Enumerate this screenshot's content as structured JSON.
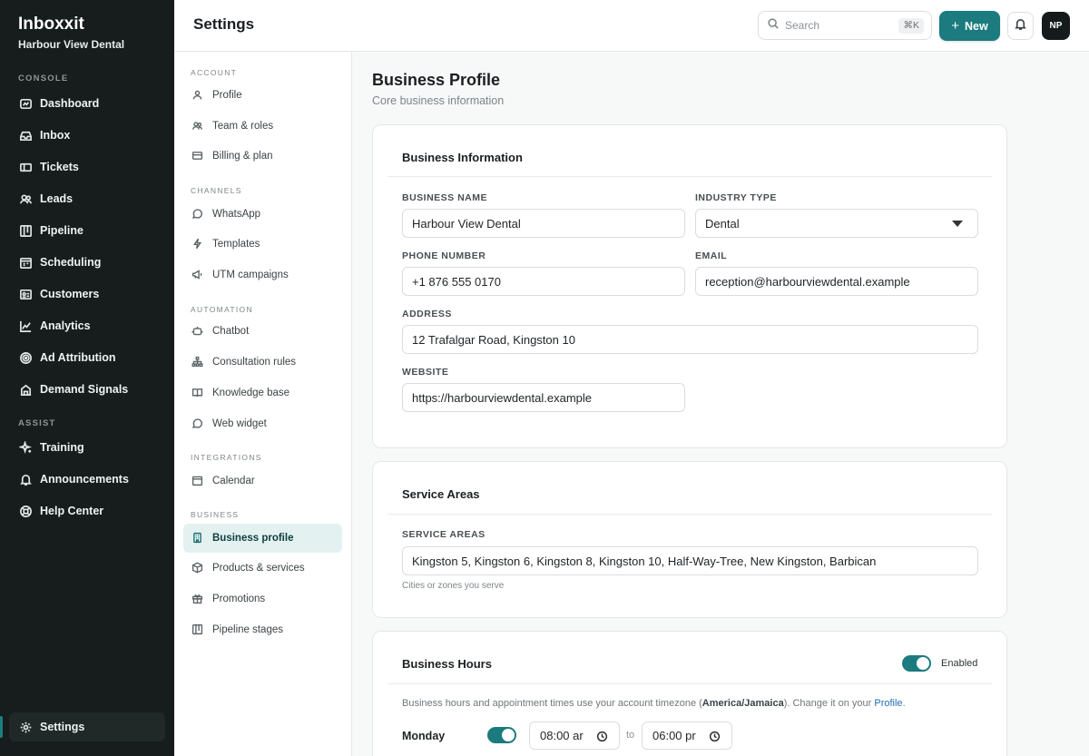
{
  "sidebar": {
    "brand": "Inboxxit",
    "org": "Harbour View Dental",
    "sections": {
      "console": "CONSOLE",
      "assist": "ASSIST"
    },
    "items": [
      {
        "label": "Dashboard",
        "icon": "dashboard-icon"
      },
      {
        "label": "Inbox",
        "icon": "inbox-icon"
      },
      {
        "label": "Tickets",
        "icon": "ticket-icon"
      },
      {
        "label": "Leads",
        "icon": "users-icon"
      },
      {
        "label": "Pipeline",
        "icon": "pipeline-icon"
      },
      {
        "label": "Scheduling",
        "icon": "calendar-icon"
      },
      {
        "label": "Customers",
        "icon": "id-card-icon"
      },
      {
        "label": "Analytics",
        "icon": "chart-line-icon"
      },
      {
        "label": "Ad Attribution",
        "icon": "target-icon"
      },
      {
        "label": "Demand Signals",
        "icon": "building-icon"
      }
    ],
    "assist_items": [
      {
        "label": "Training",
        "icon": "sparkle-icon"
      },
      {
        "label": "Announcements",
        "icon": "bell-icon"
      },
      {
        "label": "Help Center",
        "icon": "lifebuoy-icon"
      }
    ],
    "settings_label": "Settings"
  },
  "header": {
    "title": "Settings",
    "search_placeholder": "Search",
    "search_shortcut": "⌘K",
    "new_label": "New",
    "avatar_initials": "NP"
  },
  "subnav": {
    "sections": {
      "account": "ACCOUNT",
      "channels": "CHANNELS",
      "automation": "AUTOMATION",
      "integrations": "INTEGRATIONS",
      "business": "BUSINESS"
    },
    "account": [
      "Profile",
      "Team & roles",
      "Billing & plan"
    ],
    "channels": [
      "WhatsApp",
      "Templates",
      "UTM campaigns"
    ],
    "automation": [
      "Chatbot",
      "Consultation rules",
      "Knowledge base",
      "Web widget"
    ],
    "integrations": [
      "Calendar"
    ],
    "business": [
      "Business profile",
      "Products & services",
      "Promotions",
      "Pipeline stages"
    ]
  },
  "main": {
    "title": "Business Profile",
    "subtitle": "Core business information",
    "info_card": {
      "title": "Business Information",
      "business_name_label": "BUSINESS NAME",
      "business_name": "Harbour View Dental",
      "industry_label": "INDUSTRY TYPE",
      "industry": "Dental",
      "phone_label": "PHONE NUMBER",
      "phone": "+1 876 555 0170",
      "email_label": "EMAIL",
      "email": "reception@harbourviewdental.example",
      "address_label": "ADDRESS",
      "address": "12 Trafalgar Road, Kingston 10",
      "website_label": "WEBSITE",
      "website": "https://harbourviewdental.example"
    },
    "areas_card": {
      "title": "Service Areas",
      "label": "SERVICE AREAS",
      "value": "Kingston 5, Kingston 6, Kingston 8, Kingston 10, Half-Way-Tree, New Kingston, Barbican",
      "hint": "Cities or zones you serve"
    },
    "hours_card": {
      "title": "Business Hours",
      "toggle_label": "Enabled",
      "enabled": true,
      "note_prefix": "Business hours and appointment times use your account timezone (",
      "timezone": "America/Jamaica",
      "note_mid": "). Change it on your ",
      "note_link": "Profile",
      "note_end": ".",
      "day": "Monday",
      "day_enabled": true,
      "open": "08:00 ar",
      "to": "to",
      "close": "06:00 pr"
    }
  },
  "colors": {
    "accent": "#1b7b7e",
    "sidebar_bg": "#171c1c"
  }
}
